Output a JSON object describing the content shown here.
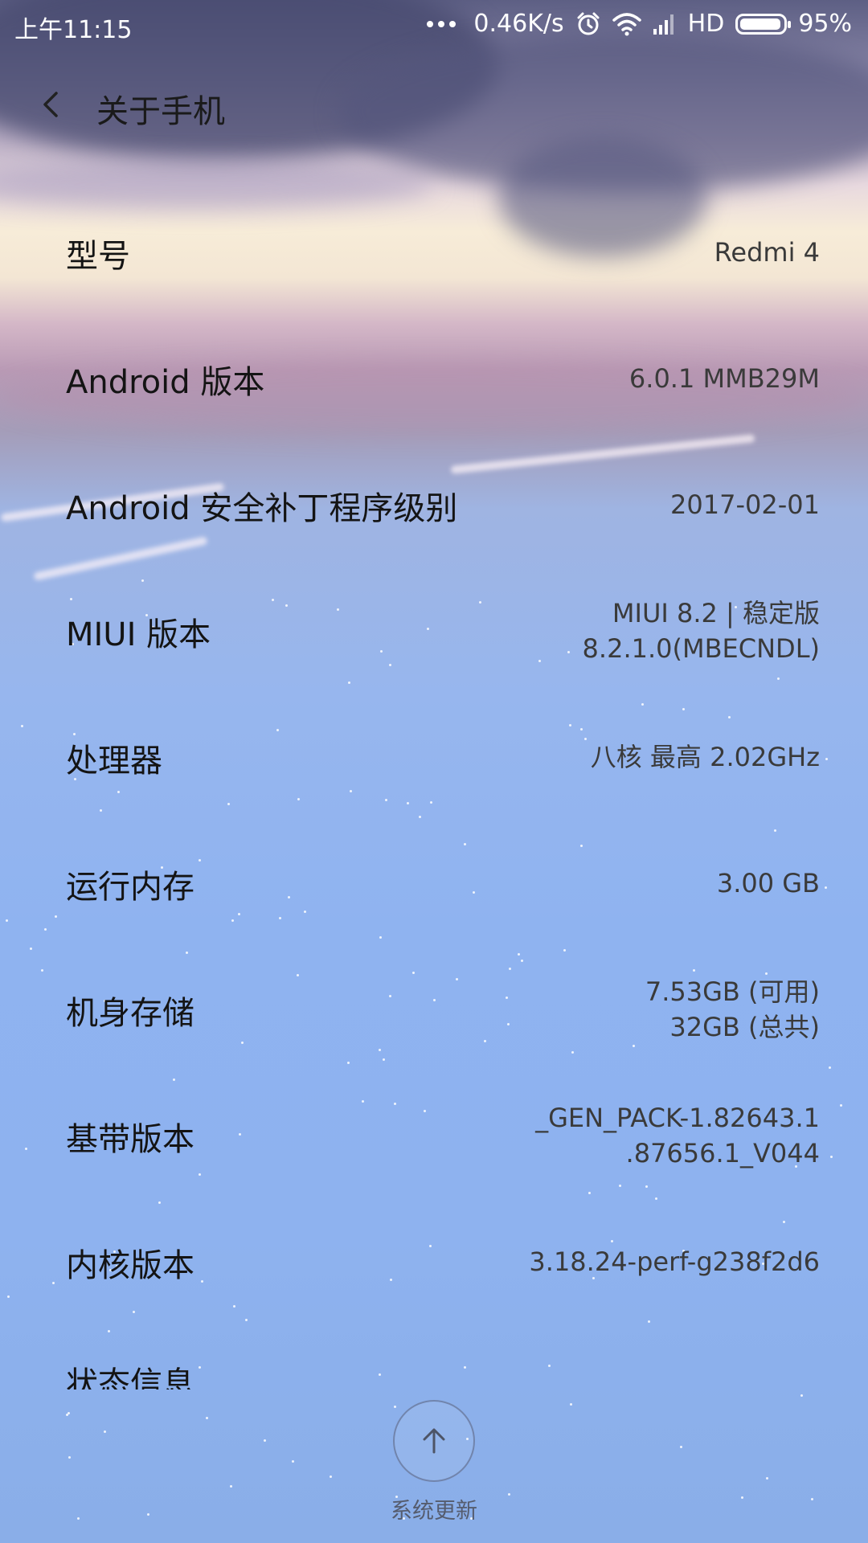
{
  "status_bar": {
    "time": "上午11:15",
    "net_speed": "0.46K/s",
    "network_type": "HD",
    "battery_text": "95%",
    "battery_level": 0.95,
    "icons": [
      "more-dots-icon",
      "alarm-icon",
      "wifi-icon",
      "signal-icon",
      "battery-icon"
    ]
  },
  "header": {
    "title": "关于手机"
  },
  "items": [
    {
      "label": "型号",
      "value": [
        "Redmi 4"
      ]
    },
    {
      "label": "Android 版本",
      "value": [
        "6.0.1 MMB29M"
      ]
    },
    {
      "label": "Android 安全补丁程序级别",
      "value": [
        "2017-02-01"
      ]
    },
    {
      "label": "MIUI 版本",
      "value": [
        "MIUI 8.2 | 稳定版",
        "8.2.1.0(MBECNDL)"
      ]
    },
    {
      "label": "处理器",
      "value": [
        "八核 最高 2.02GHz"
      ]
    },
    {
      "label": "运行内存",
      "value": [
        "3.00 GB"
      ]
    },
    {
      "label": "机身存储",
      "value": [
        "7.53GB (可用)",
        "32GB (总共)"
      ]
    },
    {
      "label": "基带版本",
      "value": [
        "_GEN_PACK-1.82643.1",
        ".87656.1_V044"
      ]
    },
    {
      "label": "内核版本",
      "value": [
        "3.18.24-perf-g238f2d6"
      ]
    },
    {
      "label": "状态信息",
      "value": []
    }
  ],
  "update": {
    "label": "系统更新",
    "icon": "arrow-up-icon"
  }
}
